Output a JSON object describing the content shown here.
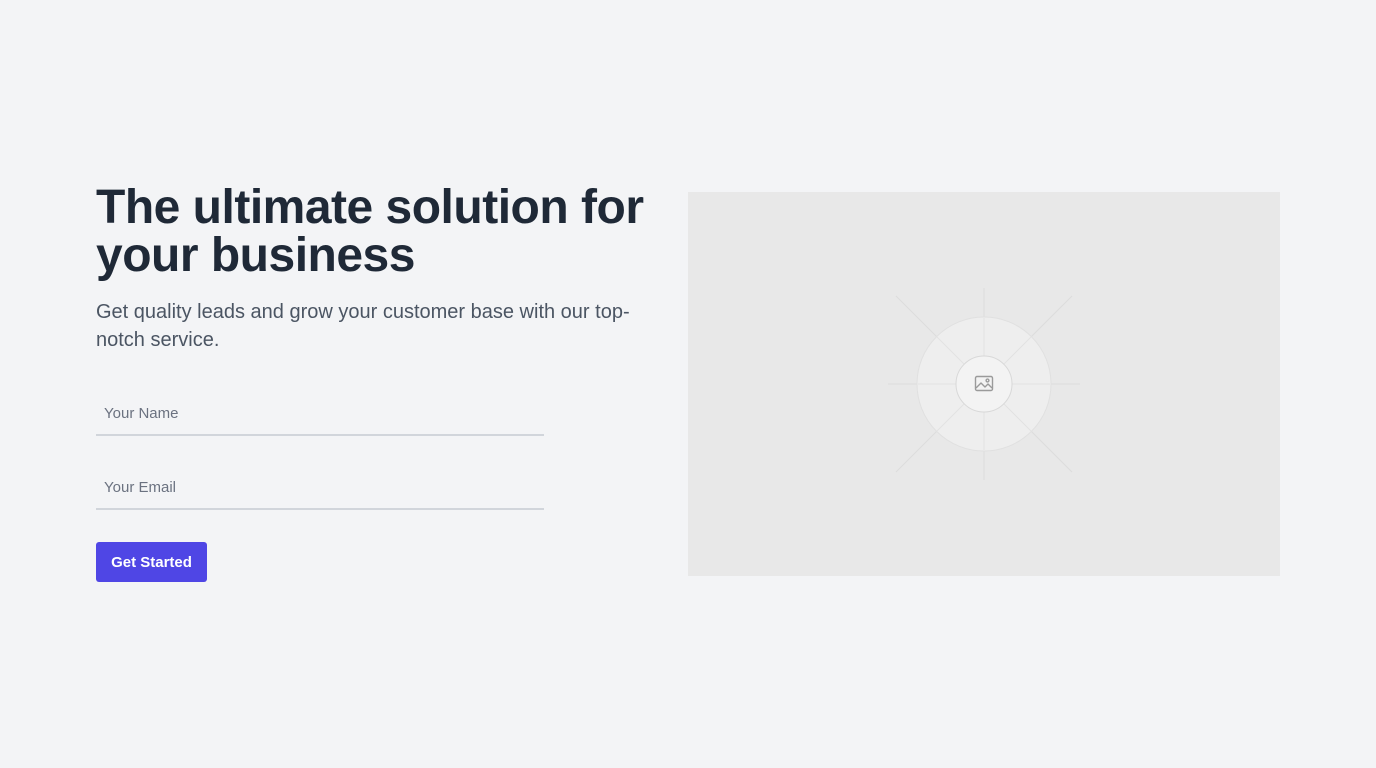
{
  "hero": {
    "title_line1": "The ultimate solution for",
    "title_line2": "your business",
    "subtitle": "Get quality leads and grow your customer base with our top-notch service."
  },
  "form": {
    "name_placeholder": "Your Name",
    "email_placeholder": "Your Email",
    "submit_label": "Get Started"
  },
  "image": {
    "icon": "image-placeholder-icon"
  },
  "colors": {
    "background": "#f3f4f6",
    "accent": "#4f46e5",
    "heading": "#1f2937",
    "text": "#4b5563",
    "image_background": "#e8e8e8"
  }
}
